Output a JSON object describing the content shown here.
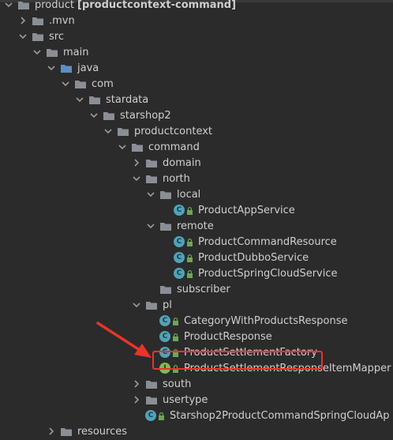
{
  "tree": [
    {
      "label": "product",
      "extra": "[productcontext-command]",
      "type": "module",
      "expanded": true,
      "level": 0
    },
    {
      "label": ".mvn",
      "type": "folder",
      "expanded": false,
      "level": 1
    },
    {
      "label": "src",
      "type": "folder",
      "expanded": true,
      "level": 1
    },
    {
      "label": "main",
      "type": "folder",
      "expanded": true,
      "level": 2
    },
    {
      "label": "java",
      "type": "source-folder",
      "expanded": true,
      "level": 3
    },
    {
      "label": "com",
      "type": "package",
      "expanded": true,
      "level": 4
    },
    {
      "label": "stardata",
      "type": "package",
      "expanded": true,
      "level": 5
    },
    {
      "label": "starshop2",
      "type": "package",
      "expanded": true,
      "level": 6
    },
    {
      "label": "productcontext",
      "type": "package",
      "expanded": true,
      "level": 7
    },
    {
      "label": "command",
      "type": "package",
      "expanded": true,
      "level": 8
    },
    {
      "label": "domain",
      "type": "package",
      "expanded": false,
      "level": 9
    },
    {
      "label": "north",
      "type": "package",
      "expanded": true,
      "level": 9
    },
    {
      "label": "local",
      "type": "package",
      "expanded": true,
      "level": 10
    },
    {
      "label": "ProductAppService",
      "type": "class",
      "level": 11
    },
    {
      "label": "remote",
      "type": "package",
      "expanded": true,
      "level": 10
    },
    {
      "label": "ProductCommandResource",
      "type": "class",
      "level": 11
    },
    {
      "label": "ProductDubboService",
      "type": "class",
      "level": 11
    },
    {
      "label": "ProductSpringCloudService",
      "type": "class",
      "level": 11
    },
    {
      "label": "subscriber",
      "type": "package",
      "level": 10
    },
    {
      "label": "pl",
      "type": "package",
      "expanded": true,
      "level": 9
    },
    {
      "label": "CategoryWithProductsResponse",
      "type": "class",
      "level": 10
    },
    {
      "label": "ProductResponse",
      "type": "class",
      "level": 10
    },
    {
      "label": "ProductSettlementFactory",
      "type": "class",
      "level": 10,
      "highlighted": true
    },
    {
      "label": "ProductSettlementResponseItemMapper",
      "type": "interface",
      "level": 10
    },
    {
      "label": "south",
      "type": "package",
      "expanded": false,
      "level": 9
    },
    {
      "label": "usertype",
      "type": "package",
      "expanded": false,
      "level": 9
    },
    {
      "label": "Starshop2ProductCommandSpringCloudAp",
      "type": "app-class",
      "level": 9
    },
    {
      "label": "resources",
      "type": "folder",
      "expanded": false,
      "level": 3
    }
  ],
  "colors": {
    "background": "#2b2b2b",
    "highlight_box": "#e8342a",
    "annotation_arrow": "#e8342a",
    "class_icon": "#4fa3b8",
    "interface_icon": "#7fba57"
  }
}
